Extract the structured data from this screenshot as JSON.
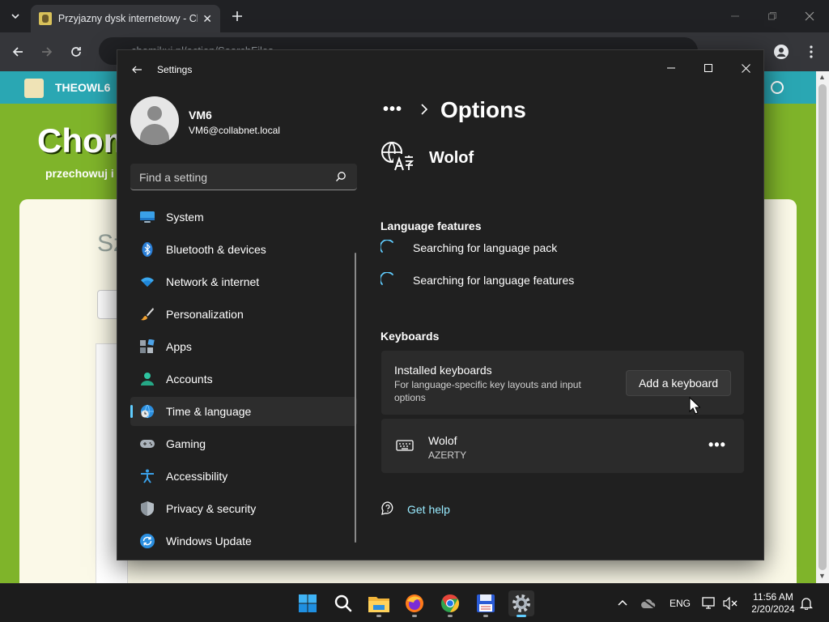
{
  "browser": {
    "tab_title": "Przyjazny dysk internetowy - Chomikuj.pl",
    "url": "chomikuj.pl/action/SearchFiles"
  },
  "webpage": {
    "brand": "THEOWL6",
    "title": "Chom",
    "subtitle": "przechowuj i",
    "card_heading": "Sz"
  },
  "settings": {
    "app_name": "Settings",
    "user": {
      "name": "VM6",
      "email": "VM6@collabnet.local"
    },
    "search_placeholder": "Find a setting",
    "nav": [
      {
        "label": "System",
        "icon": "system-icon"
      },
      {
        "label": "Bluetooth & devices",
        "icon": "bluetooth-icon"
      },
      {
        "label": "Network & internet",
        "icon": "wifi-icon"
      },
      {
        "label": "Personalization",
        "icon": "brush-icon"
      },
      {
        "label": "Apps",
        "icon": "apps-icon"
      },
      {
        "label": "Accounts",
        "icon": "account-icon"
      },
      {
        "label": "Time & language",
        "icon": "globe-clock-icon",
        "selected": true
      },
      {
        "label": "Gaming",
        "icon": "gamepad-icon"
      },
      {
        "label": "Accessibility",
        "icon": "accessibility-icon"
      },
      {
        "label": "Privacy & security",
        "icon": "shield-icon"
      },
      {
        "label": "Windows Update",
        "icon": "update-icon"
      }
    ],
    "breadcrumb_dots": "•••",
    "page_title": "Options",
    "language_name": "Wolof",
    "language_features": {
      "heading": "Language features",
      "items": [
        "Searching for language pack",
        "Searching for language features"
      ]
    },
    "keyboards": {
      "heading": "Keyboards",
      "installed_title": "Installed keyboards",
      "installed_desc": "For language-specific key layouts and input options",
      "add_button": "Add a keyboard",
      "keyboard_name": "Wolof",
      "keyboard_layout": "AZERTY",
      "more": "•••"
    },
    "get_help": "Get help"
  },
  "taskbar": {
    "language": "ENG",
    "time": "11:56 AM",
    "date": "2/20/2024"
  },
  "colors": {
    "accent": "#60cdff",
    "window_bg": "#202020",
    "card_bg": "#2b2b2b"
  }
}
